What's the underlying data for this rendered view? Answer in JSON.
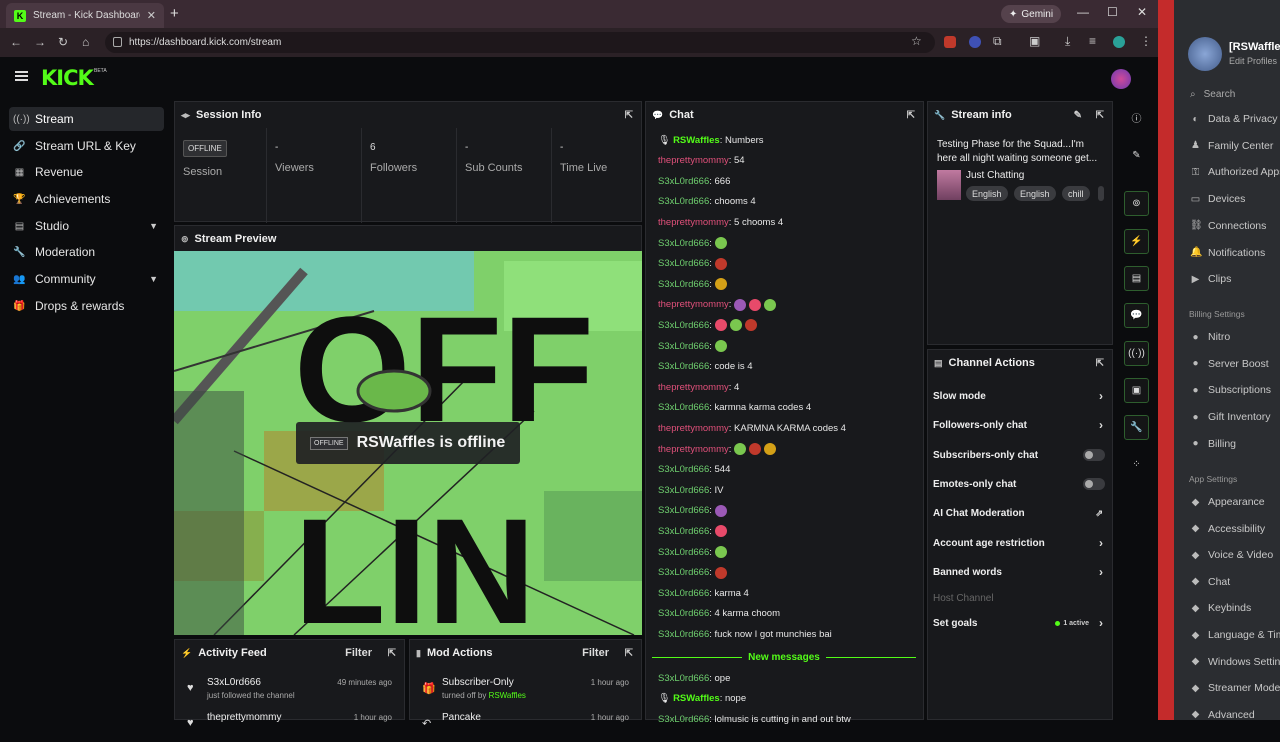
{
  "browser": {
    "tab_title": "Stream - Kick Dashboard",
    "url": "https://dashboard.kick.com/stream",
    "gemini_label": "Gemini"
  },
  "header": {
    "logo": "KICK",
    "beta": "BETA"
  },
  "nav": {
    "items": [
      {
        "label": "Stream",
        "icon": "broadcast-icon"
      },
      {
        "label": "Stream URL & Key",
        "icon": "link-icon"
      },
      {
        "label": "Revenue",
        "icon": "chart-icon"
      },
      {
        "label": "Achievements",
        "icon": "trophy-icon"
      },
      {
        "label": "Studio",
        "icon": "studio-icon"
      },
      {
        "label": "Moderation",
        "icon": "wrench-icon"
      },
      {
        "label": "Community",
        "icon": "people-icon"
      },
      {
        "label": "Drops & rewards",
        "icon": "gift-icon"
      }
    ]
  },
  "session": {
    "title": "Session Info",
    "badge": "OFFLINE",
    "session_label": "Session",
    "stats": [
      {
        "value": "-",
        "label": "Viewers"
      },
      {
        "value": "6",
        "label": "Followers"
      },
      {
        "value": "-",
        "label": "Sub Counts"
      },
      {
        "value": "-",
        "label": "Time Live"
      }
    ]
  },
  "preview": {
    "title": "Stream Preview",
    "badge": "OFFLINE",
    "text": "RSWaffles is offline"
  },
  "activity": {
    "title": "Activity Feed",
    "filter": "Filter",
    "items": [
      {
        "name": "S3xL0rd666",
        "sub": "just followed the channel",
        "time": "49 minutes ago"
      },
      {
        "name": "theprettymommy",
        "sub": "",
        "time": "1 hour ago"
      }
    ]
  },
  "mod": {
    "title": "Mod Actions",
    "filter": "Filter",
    "items": [
      {
        "name": "Subscriber-Only",
        "sub": "turned off by",
        "by": "RSWaffles",
        "time": "1 hour ago"
      },
      {
        "name": "Pancake",
        "sub": "",
        "by": "",
        "time": "1 hour ago"
      }
    ]
  },
  "chat": {
    "title": "Chat",
    "new_messages": "New messages",
    "messages": [
      {
        "user": "RSWaffles",
        "cls": "u1",
        "text": ": Numbers",
        "emotes": 0
      },
      {
        "user": "theprettymommy",
        "cls": "u2",
        "text": ": 54",
        "emotes": 0
      },
      {
        "user": "S3xL0rd666",
        "cls": "u3",
        "text": ": 666",
        "emotes": 0
      },
      {
        "user": "S3xL0rd666",
        "cls": "u3",
        "text": ": chooms 4",
        "emotes": 0
      },
      {
        "user": "theprettymommy",
        "cls": "u2",
        "text": ": 5 chooms 4",
        "emotes": 0
      },
      {
        "user": "S3xL0rd666",
        "cls": "u3",
        "text": ":",
        "emotes": 1
      },
      {
        "user": "S3xL0rd666",
        "cls": "u3",
        "text": ":",
        "emotes": 1
      },
      {
        "user": "S3xL0rd666",
        "cls": "u3",
        "text": ":",
        "emotes": 1
      },
      {
        "user": "theprettymommy",
        "cls": "u2",
        "text": ":",
        "emotes": 3
      },
      {
        "user": "S3xL0rd666",
        "cls": "u3",
        "text": ":",
        "emotes": 3
      },
      {
        "user": "S3xL0rd666",
        "cls": "u3",
        "text": ":",
        "emotes": 1
      },
      {
        "user": "S3xL0rd666",
        "cls": "u3",
        "text": ": code is 4",
        "emotes": 0
      },
      {
        "user": "theprettymommy",
        "cls": "u2",
        "text": ": 4",
        "emotes": 0
      },
      {
        "user": "S3xL0rd666",
        "cls": "u3",
        "text": ": karmna karma codes 4",
        "emotes": 0
      },
      {
        "user": "theprettymommy",
        "cls": "u2",
        "text": ": KARMNA KARMA codes 4",
        "emotes": 0
      },
      {
        "user": "theprettymommy",
        "cls": "u2",
        "text": ":",
        "emotes": 3
      },
      {
        "user": "S3xL0rd666",
        "cls": "u3",
        "text": ": 544",
        "emotes": 0
      },
      {
        "user": "S3xL0rd666",
        "cls": "u3",
        "text": ": IV",
        "emotes": 0
      },
      {
        "user": "S3xL0rd666",
        "cls": "u3",
        "text": ":",
        "emotes": 1
      },
      {
        "user": "S3xL0rd666",
        "cls": "u3",
        "text": ":",
        "emotes": 1
      },
      {
        "user": "S3xL0rd666",
        "cls": "u3",
        "text": ":",
        "emotes": 1
      },
      {
        "user": "S3xL0rd666",
        "cls": "u3",
        "text": ":",
        "emotes": 1
      },
      {
        "user": "S3xL0rd666",
        "cls": "u3",
        "text": ": karma 4",
        "emotes": 0
      },
      {
        "user": "S3xL0rd666",
        "cls": "u3",
        "text": ": 4 karma choom",
        "emotes": 0
      },
      {
        "user": "S3xL0rd666",
        "cls": "u3",
        "text": ": fuck now I got munchies bai",
        "emotes": 0
      }
    ],
    "after": [
      {
        "user": "S3xL0rd666",
        "cls": "u3",
        "text": ": ope"
      },
      {
        "user": "RSWaffles",
        "cls": "u1",
        "text": ": nope"
      },
      {
        "user": "S3xL0rd666",
        "cls": "u3",
        "text": ": lolmusic is cutting in and out btw"
      }
    ]
  },
  "stream_info": {
    "title": "Stream info",
    "stream_title": "Testing Phase for the Squad...I'm here all night waiting someone get...",
    "category": "Just Chatting",
    "tags": [
      "English",
      "English",
      "chill"
    ]
  },
  "channel_actions": {
    "title": "Channel Actions",
    "items": [
      {
        "label": "Slow mode",
        "kind": "arrow"
      },
      {
        "label": "Followers-only chat",
        "kind": "arrow"
      },
      {
        "label": "Subscribers-only chat",
        "kind": "toggle"
      },
      {
        "label": "Emotes-only chat",
        "kind": "toggle"
      },
      {
        "label": "AI Chat Moderation",
        "kind": "external"
      },
      {
        "label": "Account age restriction",
        "kind": "arrow"
      },
      {
        "label": "Banned words",
        "kind": "arrow"
      },
      {
        "label": "Host Channel",
        "kind": "dim"
      },
      {
        "label": "Set goals",
        "kind": "active",
        "active_text": "1 active"
      }
    ]
  },
  "discord": {
    "name": "[RSWaffles]",
    "edit": "Edit Profiles",
    "search": "Search",
    "items_top": [
      "Data & Privacy",
      "Family Center",
      "Authorized Apps",
      "Devices",
      "Connections",
      "Notifications",
      "Clips"
    ],
    "billing_section": "Billing Settings",
    "items_billing": [
      "Nitro",
      "Server Boost",
      "Subscriptions",
      "Gift Inventory",
      "Billing"
    ],
    "app_section": "App Settings",
    "items_app": [
      "Appearance",
      "Accessibility",
      "Voice & Video",
      "Chat",
      "Keybinds",
      "Language & Time",
      "Windows Settings",
      "Streamer Mode",
      "Advanced"
    ]
  }
}
